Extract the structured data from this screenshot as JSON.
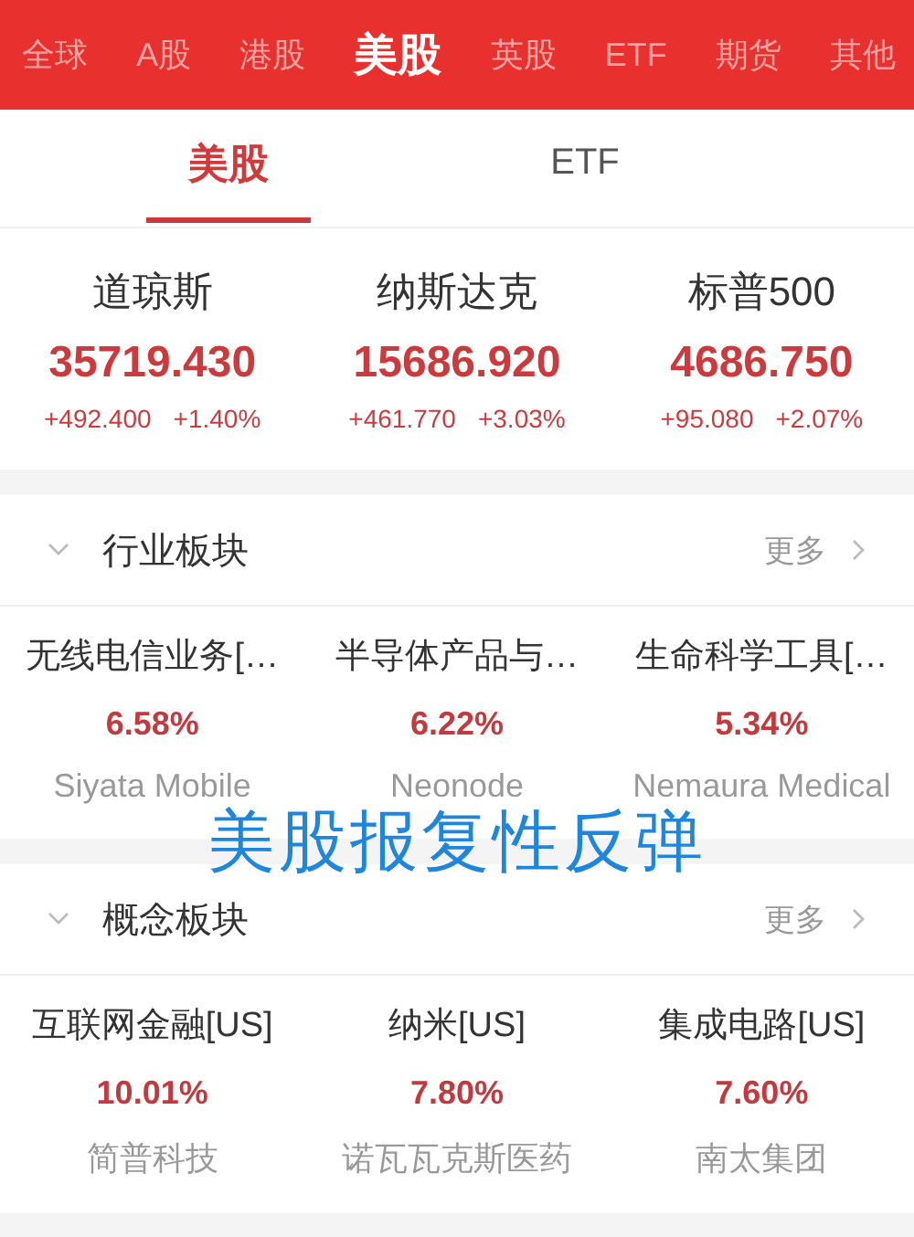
{
  "market_tabs": [
    {
      "label": "全球",
      "selected": false
    },
    {
      "label": "A股",
      "selected": false
    },
    {
      "label": "港股",
      "selected": false
    },
    {
      "label": "美股",
      "selected": true
    },
    {
      "label": "英股",
      "selected": false
    },
    {
      "label": "ETF",
      "selected": false
    },
    {
      "label": "期货",
      "selected": false
    },
    {
      "label": "其他",
      "selected": false
    }
  ],
  "sub_tabs": [
    {
      "label": "美股",
      "selected": true
    },
    {
      "label": "ETF",
      "selected": false
    }
  ],
  "indices": [
    {
      "name": "道琼斯",
      "price": "35719.430",
      "change": "+492.400",
      "percent": "+1.40%"
    },
    {
      "name": "纳斯达克",
      "price": "15686.920",
      "change": "+461.770",
      "percent": "+3.03%"
    },
    {
      "name": "标普500",
      "price": "4686.750",
      "change": "+95.080",
      "percent": "+2.07%"
    }
  ],
  "sections": [
    {
      "title": "行业板块",
      "more": "更多",
      "items": [
        {
          "name": "无线电信业务[…",
          "percent": "6.58%",
          "leader": "Siyata Mobile"
        },
        {
          "name": "半导体产品与…",
          "percent": "6.22%",
          "leader": "Neonode"
        },
        {
          "name": "生命科学工具[…",
          "percent": "5.34%",
          "leader": "Nemaura Medical"
        }
      ]
    },
    {
      "title": "概念板块",
      "more": "更多",
      "items": [
        {
          "name": "互联网金融[US]",
          "percent": "10.01%",
          "leader": "简普科技"
        },
        {
          "name": "纳米[US]",
          "percent": "7.80%",
          "leader": "诺瓦瓦克斯医药"
        },
        {
          "name": "集成电路[US]",
          "percent": "7.60%",
          "leader": "南太集团"
        }
      ]
    }
  ],
  "caption": "美股报复性反弹"
}
